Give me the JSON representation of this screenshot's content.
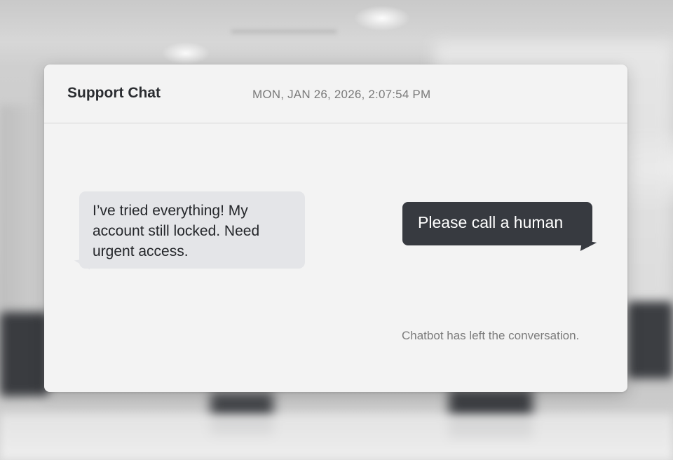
{
  "chat": {
    "title": "Support Chat",
    "timestamp": "MON, JAN 26, 2026, 2:07:54 PM"
  },
  "messages": [
    {
      "sender": "user",
      "text": "I’ve tried everything! My account still locked. Need urgent access."
    },
    {
      "sender": "agent",
      "text": "Please call a human"
    }
  ],
  "system_note": "Chatbot has left the conversation.",
  "colors": {
    "card_background": "#f3f3f3",
    "incoming_bubble": "#e4e5e8",
    "outgoing_bubble": "#373a40",
    "outgoing_text": "#ffffff",
    "muted_text": "#7a7a7a"
  }
}
